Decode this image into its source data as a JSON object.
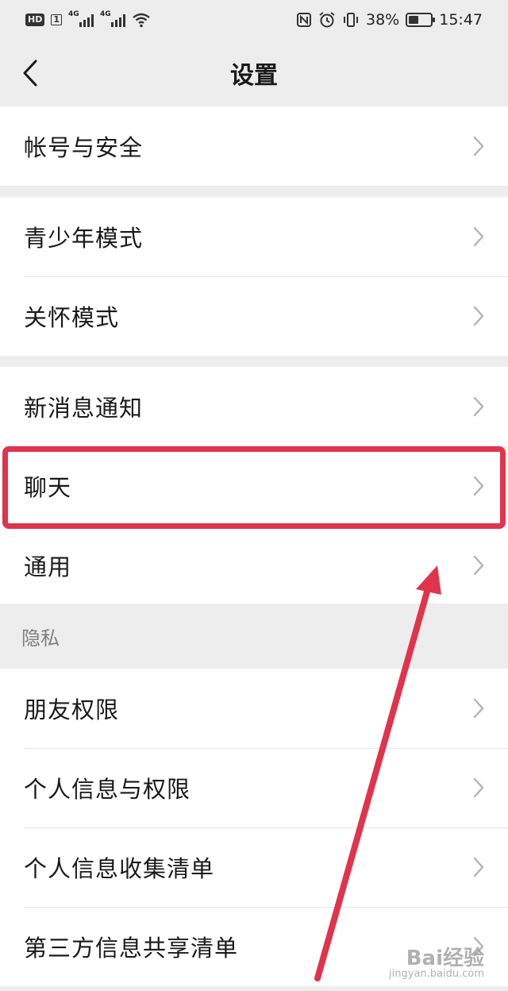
{
  "status_bar": {
    "hd": "HD",
    "sim": "1",
    "net1": "4G",
    "net2": "4G",
    "battery": "38%",
    "time": "15:47"
  },
  "nav": {
    "title": "设置"
  },
  "groups": {
    "account": [
      "帐号与安全"
    ],
    "modes": [
      "青少年模式",
      "关怀模式"
    ],
    "general": [
      "新消息通知",
      "聊天",
      "通用"
    ]
  },
  "privacy": {
    "header": "隐私",
    "items": [
      "朋友权限",
      "个人信息与权限",
      "个人信息收集清单",
      "第三方信息共享清单"
    ]
  },
  "annotation": {
    "color": "#e0344c",
    "highlighted_item": "聊天"
  },
  "watermark": {
    "text": "Bai经验",
    "url": "jingyan.baidu.com"
  },
  "icons": [
    "back-icon",
    "chevron-right-icon",
    "nfc-icon",
    "alarm-icon",
    "vibrate-icon",
    "wifi-icon",
    "battery-icon"
  ]
}
